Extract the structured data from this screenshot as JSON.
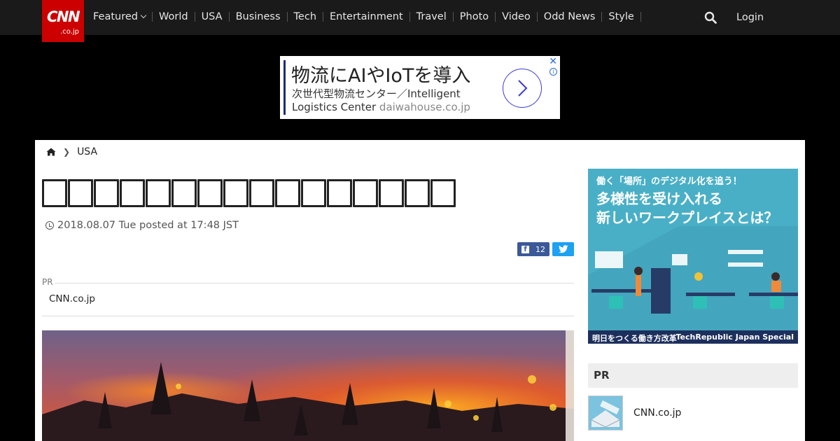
{
  "nav": {
    "logo_text": "CNN",
    "logo_sub": ".co.jp",
    "items": [
      {
        "label": "Featured"
      },
      {
        "label": "World"
      },
      {
        "label": "USA"
      },
      {
        "label": "Business"
      },
      {
        "label": "Tech"
      },
      {
        "label": "Entertainment"
      },
      {
        "label": "Travel"
      },
      {
        "label": "Photo"
      },
      {
        "label": "Video"
      },
      {
        "label": "Odd News"
      },
      {
        "label": "Style"
      }
    ],
    "login_label": "Login",
    "colors": {
      "bar": "#1a1a1a",
      "logo": "#cc0000"
    }
  },
  "top_ad": {
    "headline": "物流にAIやIoTを導入",
    "subline": "次世代型物流センター／Intelligent Logistics Center",
    "domain": "daiwahouse.co.jp",
    "close_symbol": "✕",
    "info_symbol": "i"
  },
  "breadcrumb": {
    "section": "USA"
  },
  "article": {
    "date": "2018.08.07 Tue posted at 17:48 JST",
    "share": {
      "facebook_count": "12"
    },
    "pr": {
      "label": "PR",
      "text": "CNN.co.jp"
    }
  },
  "sidebar": {
    "ad": {
      "line1": "働く「場所」のデジタル化を追う！",
      "line2": "多様性を受け入れる",
      "line3": "新しいワークプレイスとは？",
      "footer_left": "明日をつくる働き方改革",
      "footer_right": "TechRepublic Japan Special"
    },
    "pr": {
      "heading": "PR",
      "item_text": "CNN.co.jp"
    }
  }
}
